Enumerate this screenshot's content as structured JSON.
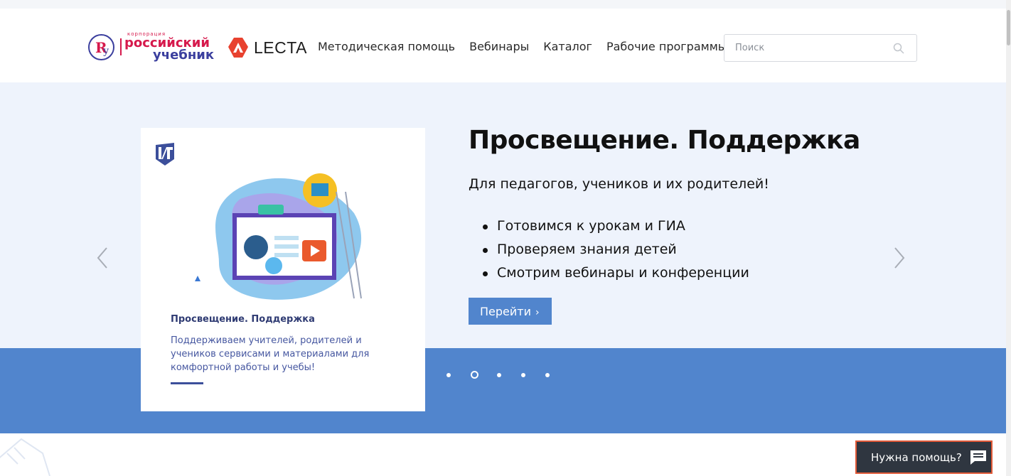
{
  "topstrip": {
    "text": ""
  },
  "header": {
    "logo_ru": {
      "small": "корпорация",
      "line1": "российский",
      "line2": "учебник"
    },
    "logo_lecta": {
      "text": "LECTA"
    },
    "nav": [
      {
        "label": "Методическая помощь"
      },
      {
        "label": "Вебинары"
      },
      {
        "label": "Каталог"
      },
      {
        "label": "Рабочие программы"
      }
    ],
    "search": {
      "placeholder": "Поиск",
      "value": ""
    }
  },
  "slider": {
    "card": {
      "title": "Просвещение. Поддержка",
      "text": "Поддерживаем учителей, родителей и учеников сервисами и материалами для комфортной работы и учебы!"
    },
    "title": "Просвещение. Поддержка",
    "subtitle": "Для педагогов, учеников и их родителей!",
    "bullets": [
      "Готовимся к урокам и ГИА",
      "Проверяем знания детей",
      "Смотрим вебинары и конференции"
    ],
    "button_label": "Перейти",
    "slide_count": 5,
    "active_slide": 2
  },
  "help_widget": {
    "label": "Нужна помощь?"
  },
  "colors": {
    "accent": "#5185cd",
    "hero_bg": "#eef3fc",
    "help_bg": "#2f3640",
    "help_border": "#e25a38",
    "brand_red": "#d6194c",
    "brand_blue": "#3b3f9e"
  },
  "icons": {
    "search": "search-icon",
    "chat": "chat-icon",
    "prev": "chevron-left-icon",
    "next": "chevron-right-icon"
  }
}
